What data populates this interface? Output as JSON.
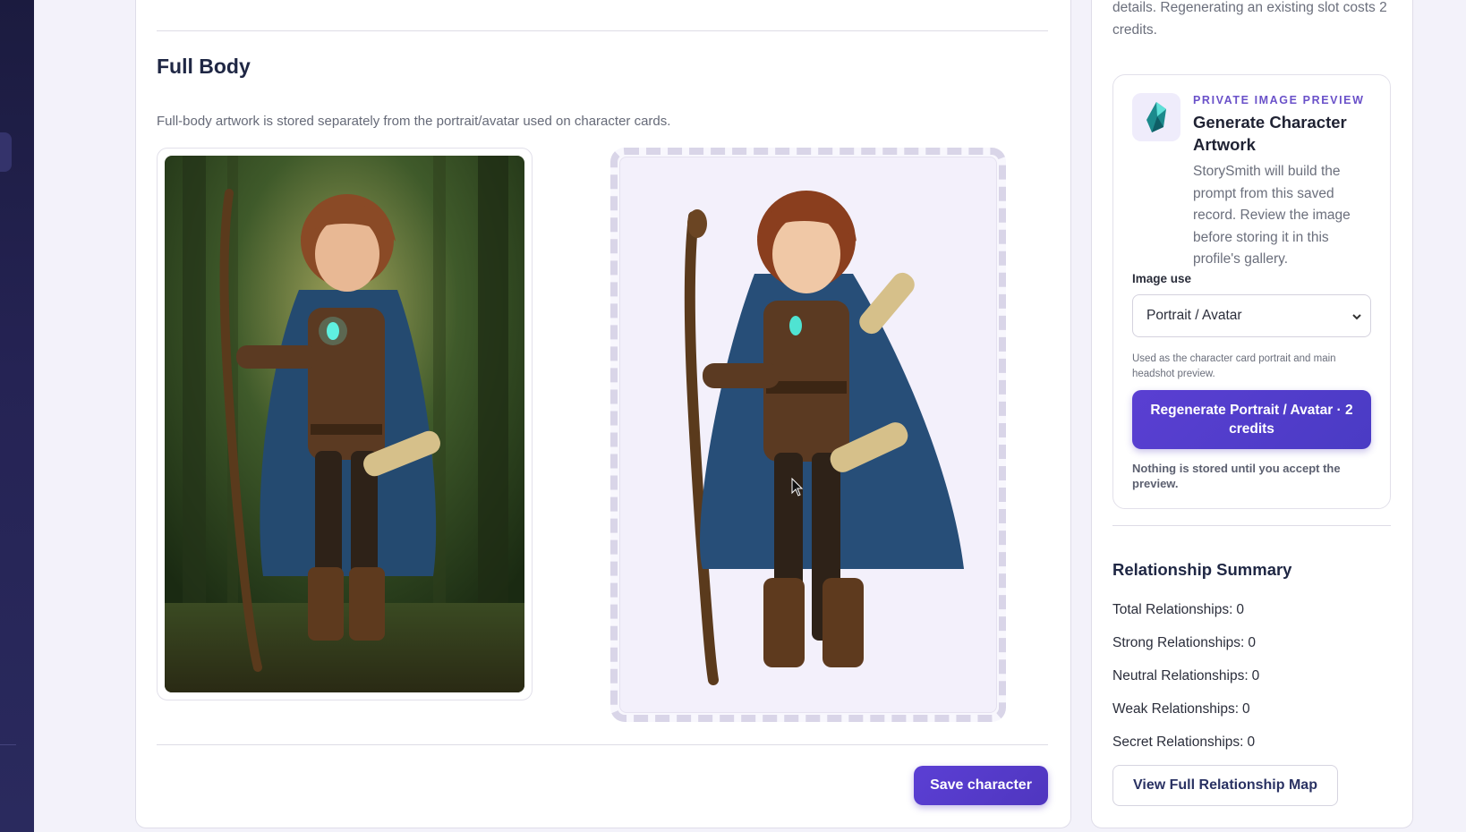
{
  "main": {
    "section_title": "Full Body",
    "section_description": "Full-body artwork is stored separately from the portrait/avatar used on character cards.",
    "current_art_icon": "character-full-body-forest",
    "preview_art_icon": "character-full-body-cutout",
    "save_label": "Save character"
  },
  "side": {
    "intro_text": "details. Regenerating an existing slot costs 2 credits.",
    "generator": {
      "icon": "crystal-icon",
      "kicker": "PRIVATE IMAGE PREVIEW",
      "title": "Generate Character Artwork",
      "description": "StorySmith will build the prompt from this saved record. Review the image before storing it in this profile's gallery.",
      "image_use_label": "Image use",
      "image_use_value": "Portrait / Avatar",
      "image_use_help": "Used as the character card portrait and main headshot preview.",
      "regenerate_label": "Regenerate Portrait / Avatar · 2 credits",
      "note": "Nothing is stored until you accept the preview."
    },
    "relationships": {
      "title": "Relationship Summary",
      "items": [
        {
          "label": "Total Relationships:",
          "value": "0"
        },
        {
          "label": "Strong Relationships:",
          "value": "0"
        },
        {
          "label": "Neutral Relationships:",
          "value": "0"
        },
        {
          "label": "Weak Relationships:",
          "value": "0"
        },
        {
          "label": "Secret Relationships:",
          "value": "0"
        }
      ],
      "map_button_label": "View Full Relationship Map"
    }
  },
  "colors": {
    "accent": "#5b3fd4",
    "sidebar": "#1f1e48",
    "kicker": "#6a51c9"
  }
}
